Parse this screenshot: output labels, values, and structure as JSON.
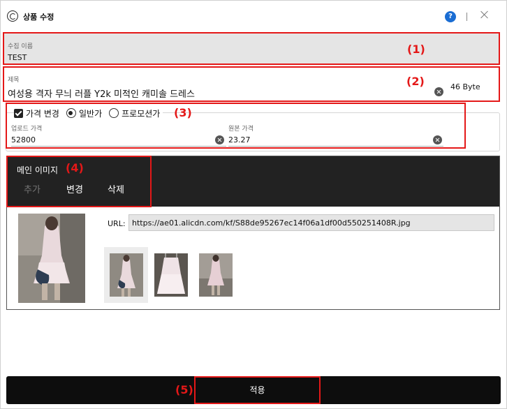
{
  "title_bar": {
    "title": "상품 수정",
    "help": "?"
  },
  "collection": {
    "label": "수집 이름",
    "value": "TEST",
    "annotation": "(1)"
  },
  "product_title": {
    "label": "제목",
    "value": "여성용 격자 무늬 러플 Y2k 미적인 캐미솔 드레스",
    "byte_count": "46 Byte",
    "annotation": "(2)"
  },
  "price": {
    "annotation": "(3)",
    "change_label": "가격 변경",
    "change_checked": true,
    "options": [
      {
        "label": "일반가",
        "selected": true
      },
      {
        "label": "프로모션가",
        "selected": false
      }
    ],
    "upload_label": "업로드 가격",
    "upload_value": "52800",
    "original_label": "원본 가격",
    "original_value": "23.27"
  },
  "main_image": {
    "title": "메인 이미지",
    "annotation": "(4)",
    "actions": [
      {
        "label": "추가",
        "enabled": false
      },
      {
        "label": "변경",
        "enabled": true
      },
      {
        "label": "삭제",
        "enabled": true
      }
    ],
    "url_label": "URL:",
    "url": "https://ae01.alicdn.com/kf/S88de95267ec14f06a1df00d550251408R.jpg",
    "selected_thumbnail": 0
  },
  "apply": {
    "label": "적용",
    "annotation": "(5)"
  },
  "colors": {
    "annotation_red": "#e41818",
    "dark_header": "#222222",
    "help_blue": "#1a6dd3"
  }
}
